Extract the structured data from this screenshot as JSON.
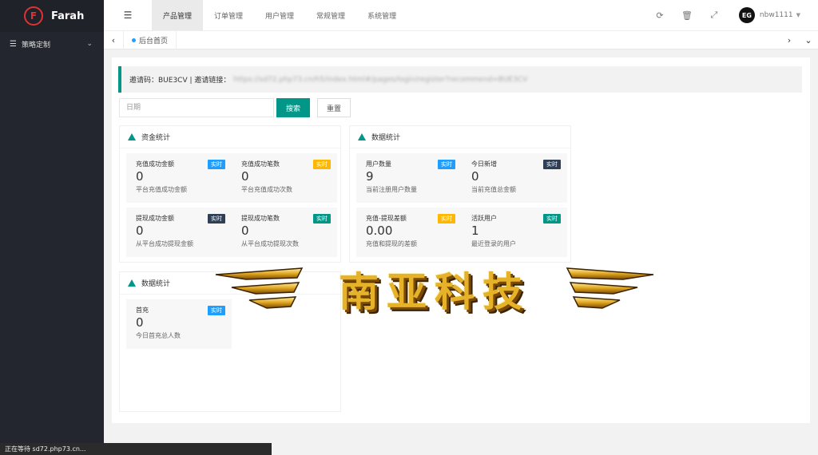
{
  "app": {
    "logo_letter": "F",
    "name": "Farah"
  },
  "sidebar": {
    "items": [
      {
        "label": "策略定制"
      }
    ]
  },
  "header": {
    "nav": [
      "产品管理",
      "订单管理",
      "用户管理",
      "常规管理",
      "系统管理"
    ],
    "active_index": 0,
    "user": {
      "avatar": "EG",
      "name": "nbw1111"
    }
  },
  "tabs": [
    {
      "label": "后台首页"
    }
  ],
  "invite": {
    "text": "邀请码：BUE3CV | 邀请链接：",
    "link_blurred": "https://sd72.php73.cn/h5/index.html#/pages/login/register?recommend=BUE3CV"
  },
  "search": {
    "placeholder": "日期",
    "search_label": "搜索",
    "reset_label": "重置"
  },
  "panels": [
    {
      "title": "资金统计",
      "stats": [
        {
          "title": "充值成功金额",
          "badge": "实时",
          "value": "0",
          "desc": "平台充值成功金额"
        },
        {
          "title": "充值成功笔数",
          "badge": "实时",
          "value": "0",
          "desc": "平台充值成功次数"
        },
        {
          "title": "提现成功金额",
          "badge": "实时",
          "value": "0",
          "desc": "从平台成功提现金额"
        },
        {
          "title": "提现成功笔数",
          "badge": "实时",
          "value": "0",
          "desc": "从平台成功提现次数"
        }
      ]
    },
    {
      "title": "数据统计",
      "stats": [
        {
          "title": "用户数量",
          "badge": "实时",
          "value": "9",
          "desc": "当前注册用户数量"
        },
        {
          "title": "今日新增",
          "badge": "实时",
          "value": "0",
          "desc": "当前充值总金额"
        },
        {
          "title": "充值-提现差额",
          "badge": "实时",
          "value": "0.00",
          "desc": "充值和提现的差额"
        },
        {
          "title": "活跃用户",
          "badge": "实时",
          "value": "1",
          "desc": "最近登录的用户"
        }
      ]
    },
    {
      "title": "数据统计",
      "stats": [
        {
          "title": "首充",
          "badge": "实时",
          "value": "0",
          "desc": "今日首充总人数"
        }
      ]
    }
  ],
  "badge_colors": {
    "blue": "#1e9fff",
    "orange": "#ffb800",
    "dark": "#2f4056",
    "teal": "#009688"
  },
  "watermark": {
    "text": "南亚科技"
  },
  "statusbar": {
    "text": "正在等待 sd72.php73.cn..."
  }
}
